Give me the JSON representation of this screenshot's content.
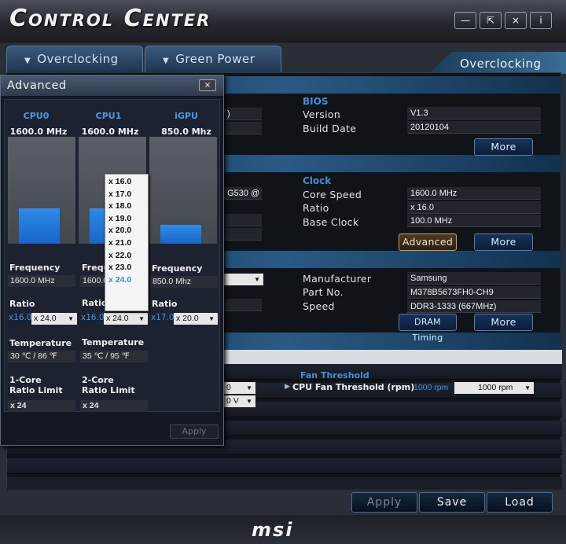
{
  "app": {
    "title": "Control Center"
  },
  "window_buttons": {
    "minimize": "—",
    "maximize": "⇱",
    "close": "×",
    "info": "i"
  },
  "tabs": {
    "overclocking": "Overclocking",
    "green_power": "Green Power",
    "current": "Overclocking"
  },
  "bios": {
    "title": "BIOS",
    "version_label": "Version",
    "version_value": "V1.3",
    "build_date_label": "Build Date",
    "build_date_value": "20120104",
    "more": "More"
  },
  "clock": {
    "title": "Clock",
    "core_speed_label": "Core Speed",
    "core_speed_value": "1600.0 MHz",
    "ratio_label": "Ratio",
    "ratio_value": "x 16.0",
    "base_clock_label": "Base Clock",
    "base_clock_value": "100.0 MHz",
    "advanced": "Advanced",
    "more": "More",
    "cpu_name_fragment": "G530 @"
  },
  "memory": {
    "manufacturer_label": "Manufacturer",
    "manufacturer_value": "Samsung",
    "part_no_label": "Part No.",
    "part_no_value": "M378B5673FH0-CH9",
    "speed_label": "Speed",
    "speed_value": "DDR3-1333 (667MHz)",
    "dram_timing": "DRAM Timing",
    "more": "More"
  },
  "fan": {
    "title": "Fan Threshold",
    "cpu_fan_label": "CPU Fan Threshold (rpm)",
    "cpu_fan_value": "1000 rpm",
    "cpu_fan_select": "1000 rpm",
    "left_select_1": "0",
    "left_select_2": "0 V"
  },
  "bottom": {
    "apply": "Apply",
    "save": "Save",
    "load": "Load"
  },
  "footer": {
    "logo": "msi"
  },
  "advanced_popup": {
    "title": "Advanced",
    "close": "×",
    "apply": "Apply",
    "cpu0": {
      "name": "CPU0",
      "mhz": "1600.0 MHz",
      "load_fraction": 0.33,
      "frequency_label": "Frequency",
      "frequency_value": "1600.0 MHz",
      "ratio_label": "Ratio",
      "ratio_current": "x16.0",
      "ratio_select": "x 24.0",
      "temperature_label": "Temperature",
      "temperature_value": "30 ℃ / 86 ℉",
      "limit_label_1": "1-Core",
      "limit_label_2": "Ratio Limit",
      "limit_value": "x 24"
    },
    "cpu1": {
      "name": "CPU1",
      "mhz": "1600.0 MHz",
      "load_fraction": 0.33,
      "frequency_label": "Frequency",
      "frequency_value": "1600.0",
      "ratio_label": "Ratio",
      "ratio_current": "x16.0",
      "ratio_select": "x 24.0",
      "temperature_label": "Temperature",
      "temperature_value": "35 ℃ / 95 ℉",
      "limit_label_1": "2-Core",
      "limit_label_2": "Ratio Limit",
      "limit_value": "x 24"
    },
    "igpu": {
      "name": "iGPU",
      "mhz": "850.0 Mhz",
      "load_fraction": 0.18,
      "frequency_label": "Frequency",
      "frequency_value": "850.0 Mhz",
      "ratio_label": "Ratio",
      "ratio_current": "x17.0",
      "ratio_select": "x 20.0"
    },
    "ratio_options": [
      "x 16.0",
      "x 17.0",
      "x 18.0",
      "x 19.0",
      "x 20.0",
      "x 21.0",
      "x 22.0",
      "x 23.0",
      "x 24.0"
    ],
    "ratio_selected": "x 24.0"
  }
}
